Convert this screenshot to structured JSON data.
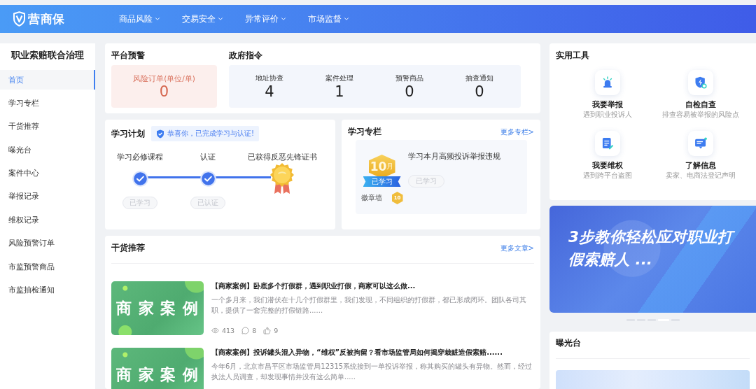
{
  "header": {
    "logo": "营商保",
    "nav": [
      {
        "label": "商品风险"
      },
      {
        "label": "交易安全"
      },
      {
        "label": "异常评价"
      },
      {
        "label": "市场监督"
      }
    ]
  },
  "sidebar": {
    "title": "职业索赔联合治理",
    "items": [
      {
        "label": "首页",
        "selected": true
      },
      {
        "label": "学习专栏",
        "selected": false
      },
      {
        "label": "干货推荐",
        "selected": false
      },
      {
        "label": "曝光台",
        "selected": false
      },
      {
        "label": "案件中心",
        "selected": false
      },
      {
        "label": "举报记录",
        "selected": false
      },
      {
        "label": "维权记录",
        "selected": false
      },
      {
        "label": "风险预警订单",
        "selected": false
      },
      {
        "label": "市监预警商品",
        "selected": false
      },
      {
        "label": "市监抽检通知",
        "selected": false
      }
    ]
  },
  "platform_warning": {
    "title": "平台预警",
    "label": "风险订单(单位/单)",
    "value": "0"
  },
  "government_orders": {
    "title": "政府指令",
    "stats": [
      {
        "label": "地址协查",
        "value": "4"
      },
      {
        "label": "案件处理",
        "value": "1"
      },
      {
        "label": "预警商品",
        "value": "0"
      },
      {
        "label": "抽查通知",
        "value": "0"
      }
    ]
  },
  "study_plan": {
    "title": "学习计划",
    "notice": "恭喜你，已完成学习与认证!",
    "steps": [
      {
        "kind": "check",
        "label": "学习必修课程",
        "done": true,
        "status": "已学习"
      },
      {
        "kind": "check",
        "label": "认证",
        "done": true,
        "status": "已认证"
      },
      {
        "kind": "medal",
        "label": "已获得反恶先锋证书"
      }
    ]
  },
  "study_column": {
    "title": "学习专栏",
    "more_link": "更多专栏>",
    "badge_number": "10",
    "badge_unit": "月",
    "badge_status": "已学习",
    "wall_label": "徽章墙",
    "wall_badges": [
      "10"
    ],
    "course_title": "学习本月高频投诉举报违规",
    "course_status": "已学习"
  },
  "articles": {
    "title": "干货推荐",
    "more_link": "更多文章>",
    "items": [
      {
        "thumbnail_caption": "商 家 案 例",
        "title": "【商家案例】卧底多个打假群，遇到职业打假，商家可以这么做...",
        "summary": "一个多月来，我们潜伏在十几个打假群里，我们发现，不同组织的打假群，都已形成闭环。团队各司其职，提供了一套完整的打假链路......",
        "views": "413",
        "comments": "8",
        "likes": "9"
      },
      {
        "thumbnail_caption": "商 家 案 例",
        "title": "【商家案例】投诉罐头混入异物，“维权”反被拘留？看市场监管局如何揭穿栽赃造假索赔......",
        "summary": "今年6月，北京市昌平区市场监管局12315系统接到一单投诉举报，称其购买的罐头有异物。然而，经过执法人员调查，却发现事情并没有这么简单....."
      }
    ]
  },
  "tools": {
    "title": "实用工具",
    "items": [
      {
        "kind": "alarm",
        "title": "我要举报",
        "subtitle": "遇到职业投诉人"
      },
      {
        "kind": "shield",
        "title": "自检自查",
        "subtitle": "排查容易被举报的风险点"
      },
      {
        "kind": "document",
        "title": "我要维权",
        "subtitle": "遇到跨平台盗图"
      },
      {
        "kind": "message",
        "title": "了解信息",
        "subtitle": "卖家、电商法登记声明"
      }
    ]
  },
  "banner": {
    "headline": "3步教你轻松应对职业打假索赔人 ...",
    "dots": [
      {
        "selected": false
      },
      {
        "selected": false
      },
      {
        "selected": false
      },
      {
        "selected": true
      },
      {
        "selected": false
      }
    ]
  },
  "exposure": {
    "title": "曝光台"
  }
}
